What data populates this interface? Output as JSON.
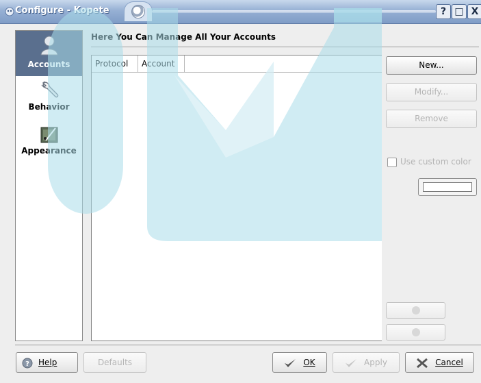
{
  "window": {
    "title": "Configure - Kopete"
  },
  "title_buttons": {
    "help": "?",
    "maximize": "□",
    "close": "X"
  },
  "sidebar": {
    "items": [
      {
        "label": "Accounts",
        "icon": "user-silhouette-icon",
        "selected": true
      },
      {
        "label": "Behavior",
        "icon": "wrench-icon",
        "selected": false
      },
      {
        "label": "Appearance",
        "icon": "paint-icon",
        "selected": false
      }
    ]
  },
  "main": {
    "heading": "Here You Can Manage All Your Accounts",
    "columns": [
      "Protocol",
      "Account"
    ],
    "rows": []
  },
  "actions": {
    "new_label": "New...",
    "modify_label": "Modify...",
    "remove_label": "Remove",
    "custom_color_label": "Use custom color",
    "custom_color_checked": false
  },
  "dialog_buttons": {
    "help": "Help",
    "defaults": "Defaults",
    "ok": "OK",
    "apply": "Apply",
    "cancel": "Cancel"
  },
  "colors": {
    "selected_sidebar": "#5a6f8e",
    "titlebar": "#8fa9d0",
    "watermark": "#bfe3ee"
  }
}
